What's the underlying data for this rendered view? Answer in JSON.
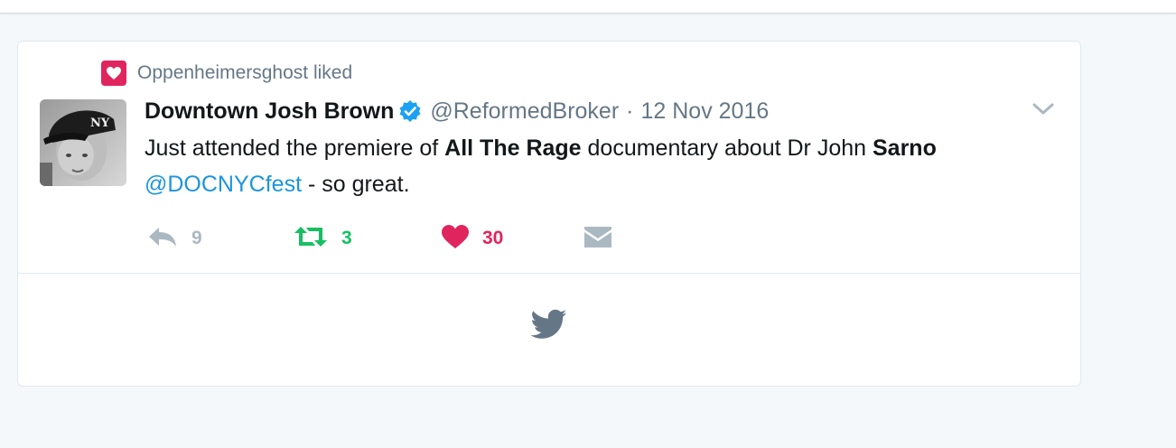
{
  "context": {
    "icon": "heart-badge-icon",
    "text": "Oppenheimersghost liked"
  },
  "tweet": {
    "author_name": "Downtown Josh Brown",
    "verified_icon": "verified-badge-icon",
    "handle": "@ReformedBroker",
    "separator": "·",
    "date": "12 Nov 2016",
    "text_segments": {
      "s1": "Just attended the premiere of ",
      "s2": "All The Rage",
      "s3": " documentary about Dr John ",
      "s4": "Sarno",
      "mention": "@DOCNYCfest",
      "s5": " - so great."
    }
  },
  "actions": {
    "reply_count": "9",
    "retweet_count": "3",
    "like_count": "30"
  },
  "colors": {
    "like": "#e0245e",
    "retweet": "#17bf63",
    "link": "#1b95e0",
    "muted": "#657786"
  }
}
